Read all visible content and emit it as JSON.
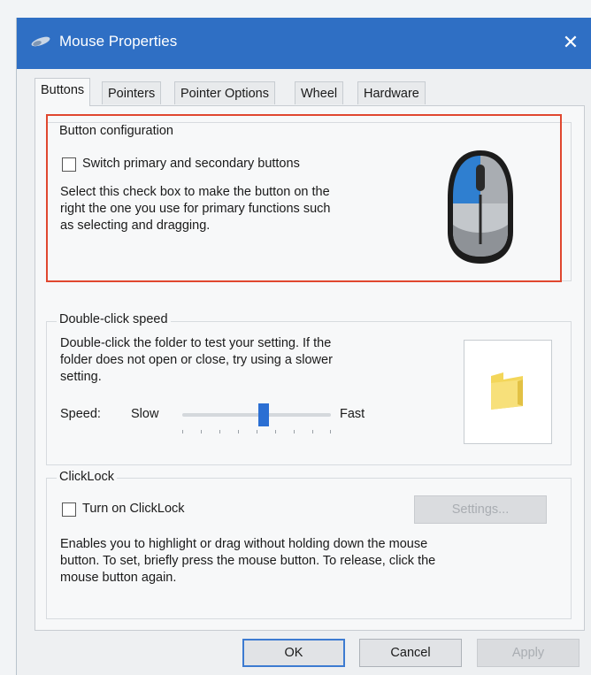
{
  "window": {
    "title": "Mouse Properties",
    "close_glyph": "✕",
    "accent_color": "#2f6fc4"
  },
  "tabs": [
    {
      "label": "Buttons",
      "active": true
    },
    {
      "label": "Pointers",
      "active": false
    },
    {
      "label": "Pointer Options",
      "active": false
    },
    {
      "label": "Wheel",
      "active": false
    },
    {
      "label": "Hardware",
      "active": false
    }
  ],
  "button_configuration": {
    "group_label": "Button configuration",
    "checkbox_label": "Switch primary and secondary buttons",
    "checked": false,
    "description_lines": [
      "Select this check box to make the button on the",
      "right the one you use for primary functions such",
      "as selecting and dragging."
    ],
    "highlight_color": "#e0472f",
    "mouse_icon": "mouse-icon"
  },
  "double_click": {
    "group_label": "Double-click speed",
    "description_lines": [
      "Double-click the folder to test your setting. If the",
      "folder does not open or close, try using a slower",
      "setting."
    ],
    "speed_label": "Speed:",
    "slow_label": "Slow",
    "fast_label": "Fast",
    "slider_value": 0.55,
    "folder_icon": "folder-icon"
  },
  "clicklock": {
    "group_label": "ClickLock",
    "checkbox_label": "Turn on ClickLock",
    "checked": false,
    "settings_button": "Settings...",
    "description_lines": [
      "Enables you to highlight or drag without holding down the mouse",
      "button. To set, briefly press the mouse button. To release, click the",
      "mouse button again."
    ]
  },
  "footer": {
    "ok": "OK",
    "cancel": "Cancel",
    "apply": "Apply"
  }
}
